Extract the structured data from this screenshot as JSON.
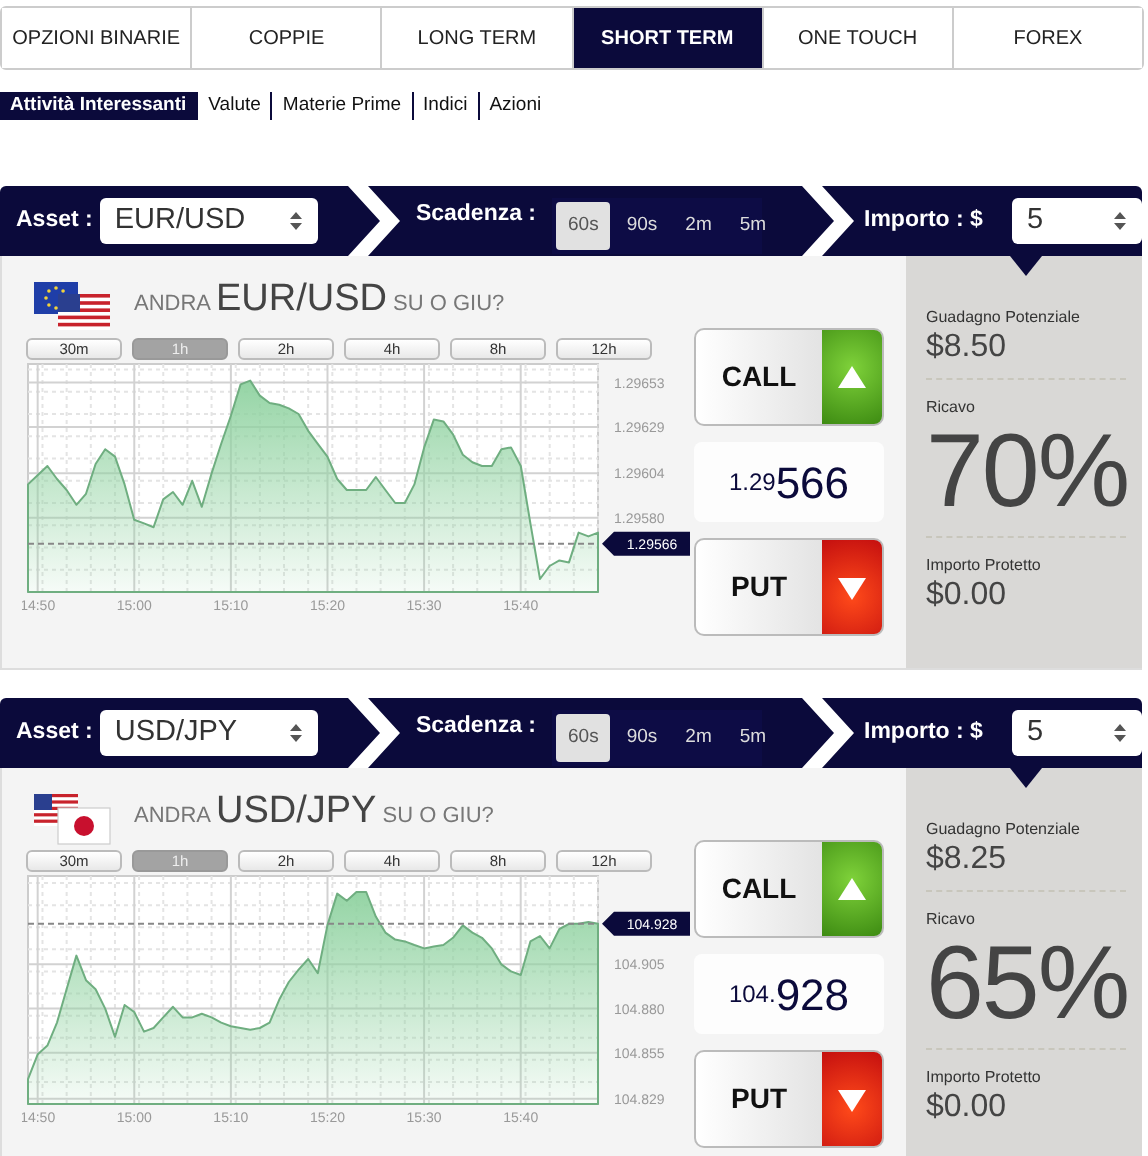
{
  "tabs": [
    {
      "label": "OPZIONI BINARIE",
      "selected": false
    },
    {
      "label": "COPPIE",
      "selected": false
    },
    {
      "label": "LONG TERM",
      "selected": false
    },
    {
      "label": "SHORT TERM",
      "selected": true
    },
    {
      "label": "ONE TOUCH",
      "selected": false
    },
    {
      "label": "FOREX",
      "selected": false
    }
  ],
  "subnav": [
    {
      "label": "Attività Interessanti",
      "selected": true
    },
    {
      "label": "Valute",
      "selected": false
    },
    {
      "label": "Materie Prime",
      "selected": false
    },
    {
      "label": "Indici",
      "selected": false
    },
    {
      "label": "Azioni",
      "selected": false
    }
  ],
  "panels": [
    {
      "asset_label": "Asset :",
      "asset": "EUR/USD",
      "expiry_label": "Scadenza :",
      "expiries": [
        {
          "label": "60s",
          "selected": true
        },
        {
          "label": "90s",
          "selected": false
        },
        {
          "label": "2m",
          "selected": false
        },
        {
          "label": "5m",
          "selected": false
        }
      ],
      "amount_label": "Importo : $",
      "amount": "5",
      "question": {
        "prefix": "ANDRA",
        "pair": "EUR/USD",
        "suffix": "SU O GIU?"
      },
      "periods": [
        {
          "label": "30m",
          "selected": false
        },
        {
          "label": "1h",
          "selected": true
        },
        {
          "label": "2h",
          "selected": false
        },
        {
          "label": "4h",
          "selected": false
        },
        {
          "label": "8h",
          "selected": false
        },
        {
          "label": "12h",
          "selected": false
        }
      ],
      "chart_data": {
        "type": "area",
        "categories": [
          null,
          "14:50",
          null,
          null,
          null,
          null,
          null,
          null,
          null,
          null,
          null,
          "15:00",
          null,
          null,
          null,
          null,
          null,
          null,
          null,
          null,
          null,
          "15:10",
          null,
          null,
          null,
          null,
          null,
          null,
          null,
          null,
          null,
          "15:20",
          null,
          null,
          null,
          null,
          null,
          null,
          null,
          null,
          null,
          "15:30",
          null,
          null,
          null,
          null,
          null,
          null,
          null,
          null,
          null,
          "15:40",
          null,
          null,
          null,
          null,
          null,
          null,
          null,
          null
        ],
        "series": [
          {
            "color": "#6fae80",
            "values": [
              1.29598,
              1.29603,
              1.29608,
              1.29601,
              1.29595,
              1.29587,
              1.29593,
              1.29609,
              1.29617,
              1.29613,
              1.29598,
              1.29579,
              1.29577,
              1.29575,
              1.2959,
              1.29594,
              1.29587,
              1.296,
              1.29586,
              1.29604,
              1.2962,
              1.29635,
              1.29652,
              1.29654,
              1.29646,
              1.29642,
              1.29641,
              1.29639,
              1.29636,
              1.29627,
              1.2962,
              1.29613,
              1.29601,
              1.29595,
              1.29595,
              1.29595,
              1.29602,
              1.29595,
              1.29588,
              1.29588,
              1.29598,
              1.29618,
              1.29633,
              1.29632,
              1.29625,
              1.29614,
              1.2961,
              1.29608,
              1.29608,
              1.29617,
              1.29618,
              1.29608,
              1.29577,
              1.29547,
              1.29554,
              1.29557,
              1.29556,
              1.29572,
              1.2957,
              1.29572
            ]
          }
        ],
        "ylim": [
          1.2954,
          1.29663
        ],
        "yticks": [
          {
            "value": 1.29653,
            "label": "1.29653"
          },
          {
            "value": 1.29629,
            "label": "1.29629"
          },
          {
            "value": 1.29604,
            "label": "1.29604"
          },
          {
            "value": 1.2958,
            "label": "1.29580"
          }
        ],
        "grid": true,
        "ref_lines": [
          {
            "axis": "y",
            "value": 1.29566,
            "label": "1.29566"
          }
        ]
      },
      "call_label": "CALL",
      "put_label": "PUT",
      "rate": {
        "prefix": "1.29",
        "digits": "566"
      },
      "stats": [
        {
          "kind": "amount",
          "label": "Guadagno Potenziale",
          "value": "$8.50"
        },
        {
          "kind": "percent",
          "label": "Ricavo",
          "value": "70%"
        },
        {
          "kind": "amount",
          "label": "Importo Protetto",
          "value": "$0.00"
        }
      ]
    },
    {
      "asset_label": "Asset :",
      "asset": "USD/JPY",
      "expiry_label": "Scadenza :",
      "expiries": [
        {
          "label": "60s",
          "selected": true
        },
        {
          "label": "90s",
          "selected": false
        },
        {
          "label": "2m",
          "selected": false
        },
        {
          "label": "5m",
          "selected": false
        }
      ],
      "amount_label": "Importo : $",
      "amount": "5",
      "question": {
        "prefix": "ANDRA",
        "pair": "USD/JPY",
        "suffix": "SU O GIU?"
      },
      "periods": [
        {
          "label": "30m",
          "selected": false
        },
        {
          "label": "1h",
          "selected": true
        },
        {
          "label": "2h",
          "selected": false
        },
        {
          "label": "4h",
          "selected": false
        },
        {
          "label": "8h",
          "selected": false
        },
        {
          "label": "12h",
          "selected": false
        }
      ],
      "chart_data": {
        "type": "area",
        "categories": [
          null,
          "14:50",
          null,
          null,
          null,
          null,
          null,
          null,
          null,
          null,
          null,
          "15:00",
          null,
          null,
          null,
          null,
          null,
          null,
          null,
          null,
          null,
          "15:10",
          null,
          null,
          null,
          null,
          null,
          null,
          null,
          null,
          null,
          "15:20",
          null,
          null,
          null,
          null,
          null,
          null,
          null,
          null,
          null,
          "15:30",
          null,
          null,
          null,
          null,
          null,
          null,
          null,
          null,
          null,
          "15:40",
          null,
          null,
          null,
          null,
          null,
          null,
          null,
          null
        ],
        "series": [
          {
            "color": "#6fae80",
            "values": [
              104.84,
              104.854,
              104.859,
              104.872,
              104.891,
              104.91,
              104.896,
              104.891,
              104.88,
              104.864,
              104.882,
              104.878,
              104.867,
              104.869,
              104.875,
              104.881,
              104.875,
              104.875,
              104.877,
              104.875,
              104.872,
              104.87,
              104.869,
              104.868,
              104.869,
              104.872,
              104.885,
              104.895,
              104.902,
              104.908,
              104.9,
              104.927,
              104.945,
              104.941,
              104.946,
              104.946,
              104.932,
              104.923,
              104.919,
              104.918,
              104.916,
              104.914,
              104.915,
              104.916,
              104.92,
              104.927,
              104.923,
              104.92,
              104.914,
              104.905,
              104.901,
              104.899,
              104.918,
              104.921,
              104.914,
              104.925,
              104.928,
              104.928,
              104.929,
              104.928
            ]
          }
        ],
        "ylim": [
          104.826,
          104.955
        ],
        "yticks": [
          {
            "value": 104.905,
            "label": "104.905"
          },
          {
            "value": 104.88,
            "label": "104.880"
          },
          {
            "value": 104.855,
            "label": "104.855"
          },
          {
            "value": 104.829,
            "label": "104.829"
          }
        ],
        "grid": true,
        "ref_lines": [
          {
            "axis": "y",
            "value": 104.928,
            "label": "104.928"
          }
        ]
      },
      "call_label": "CALL",
      "put_label": "PUT",
      "rate": {
        "prefix": "104.",
        "digits": "928"
      },
      "stats": [
        {
          "kind": "amount",
          "label": "Guadagno Potenziale",
          "value": "$8.25"
        },
        {
          "kind": "percent",
          "label": "Ricavo",
          "value": "65%"
        },
        {
          "kind": "amount",
          "label": "Importo Protetto",
          "value": "$0.00"
        }
      ]
    }
  ]
}
